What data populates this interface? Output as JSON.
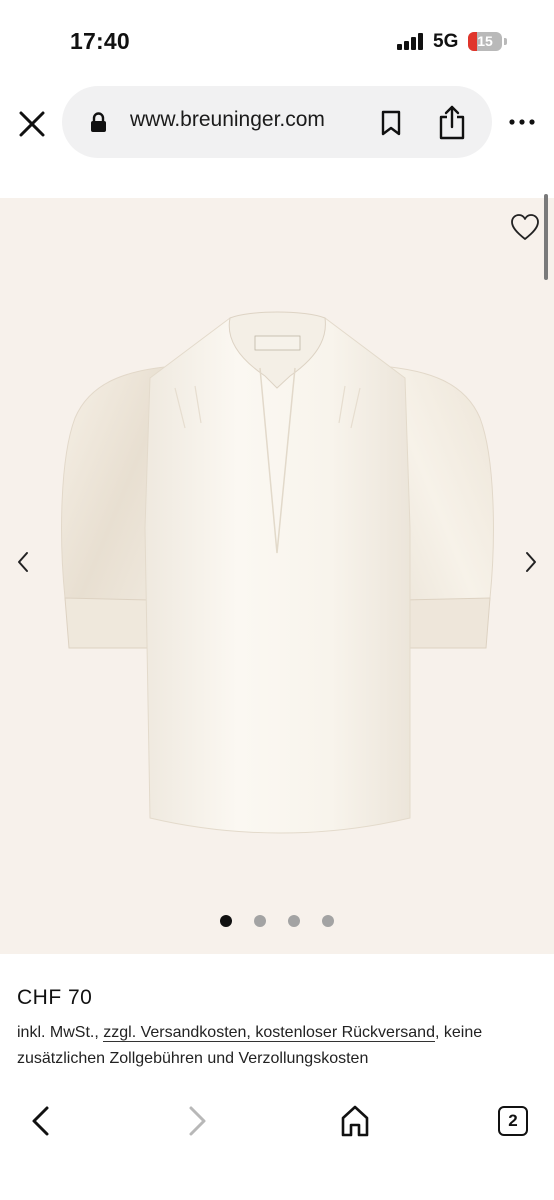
{
  "status_bar": {
    "time": "17:40",
    "network": "5G",
    "battery": "15",
    "battery_color": "#e0352b"
  },
  "browser": {
    "url": "www.breuninger.com",
    "icons": [
      "close-icon",
      "lock-icon",
      "bookmark-icon",
      "share-icon",
      "more-icon"
    ]
  },
  "product": {
    "image_bg": "#f7f1eb",
    "image_count": 4,
    "active_image": 1,
    "price": "CHF 70",
    "note_prefix": "inkl. MwSt., ",
    "note_link": "zzgl. Versandkosten, kostenloser Rückversand",
    "note_suffix": ", keine zusätzlichen Zollgebühren und Verzollungskosten"
  },
  "toolbar": {
    "tabs_count": "2",
    "icons": [
      "back-icon",
      "forward-icon",
      "home-icon",
      "tabs-icon"
    ]
  }
}
